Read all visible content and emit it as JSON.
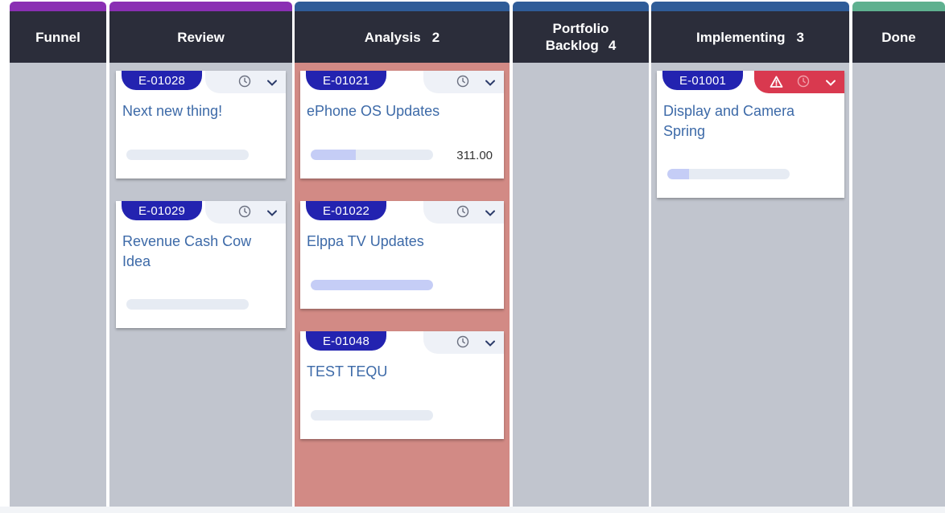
{
  "columns": [
    {
      "name": "Funnel",
      "count": "",
      "bar_color": "#8a2fb3"
    },
    {
      "name": "Review",
      "count": "",
      "bar_color": "#8a2fb3"
    },
    {
      "name": "Analysis",
      "count": "2",
      "bar_color": "#2f5c98"
    },
    {
      "name_line1": "Portfolio",
      "name_line2": "Backlog",
      "count": "4",
      "bar_color": "#2f5c98"
    },
    {
      "name": "Implementing",
      "count": "3",
      "bar_color": "#2f5c98"
    },
    {
      "name": "Done",
      "count": "",
      "bar_color": "#5fb08f"
    }
  ],
  "cards": {
    "review": [
      {
        "id": "E-01028",
        "title": "Next new thing!",
        "progress": 0.0,
        "value": ""
      },
      {
        "id": "E-01029",
        "title": "Revenue Cash Cow Idea",
        "progress": 0.0,
        "value": ""
      }
    ],
    "analysis": [
      {
        "id": "E-01021",
        "title": "ePhone OS Updates",
        "progress": 0.37,
        "value": "311.00"
      },
      {
        "id": "E-01022",
        "title": "Elppa TV Updates",
        "progress": 1.0,
        "value": ""
      },
      {
        "id": "E-01048",
        "title": "TEST TEQU",
        "progress": 0.0,
        "value": ""
      }
    ],
    "implementing": [
      {
        "id": "E-01001",
        "title": "Display and Camera Spring",
        "progress": 0.18,
        "value": "",
        "alert": true
      }
    ]
  },
  "icons": {
    "clock": "clock-icon",
    "chevron": "chevron-down-icon",
    "warning": "warning-icon"
  },
  "colors": {
    "header_bg": "#2b2d3a",
    "column_bg": "#c1c5ce",
    "analysis_bg": "#d28a85",
    "id_badge": "#2323b0",
    "title_text": "#3d6aa8",
    "alert_red": "#d9394f"
  }
}
